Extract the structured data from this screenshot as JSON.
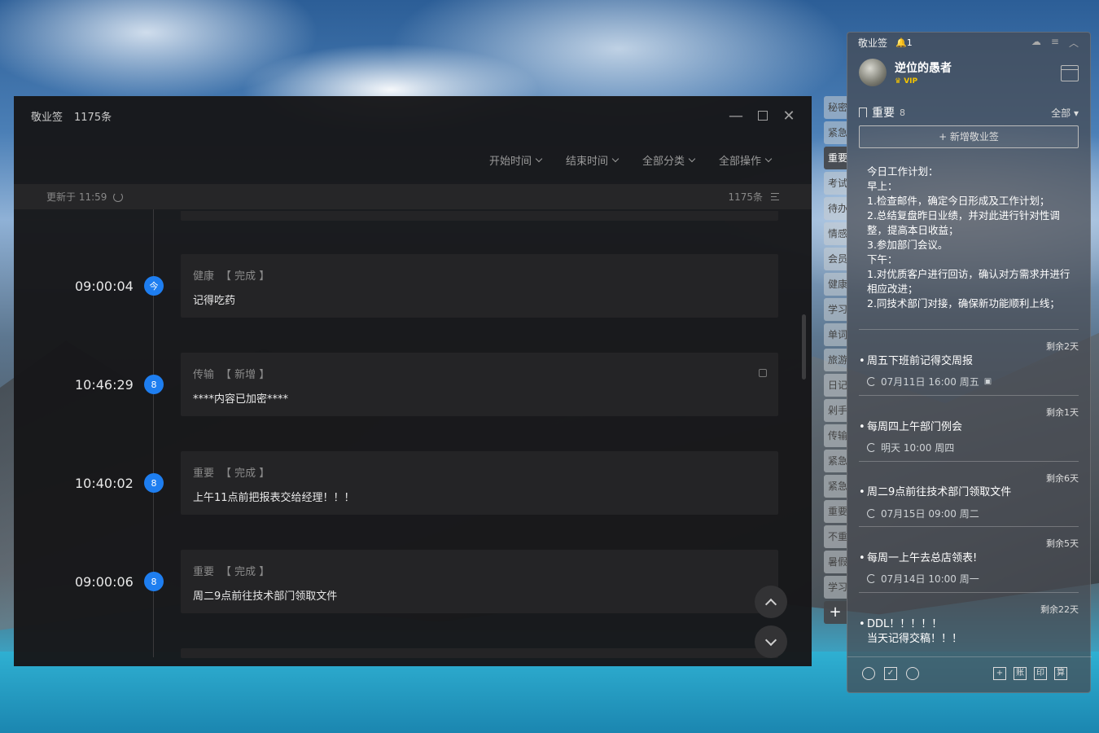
{
  "main": {
    "app_name": "敬业签",
    "total": "1175条",
    "filters": [
      "开始时间",
      "结束时间",
      "全部分类",
      "全部操作"
    ],
    "updated": "更新于 11:59",
    "count": "1175条",
    "entries": [
      {
        "time": "09:00:04",
        "badge": "今",
        "category": "健康",
        "status": "【 完成 】",
        "content": "记得吃药"
      },
      {
        "time": "10:46:29",
        "badge": "8",
        "category": "传输",
        "status": "【 新增 】",
        "content": "****内容已加密****"
      },
      {
        "time": "10:40:02",
        "badge": "8",
        "category": "重要",
        "status": "【 完成 】",
        "content": "上午11点前把报表交给经理！！！"
      },
      {
        "time": "09:00:06",
        "badge": "8",
        "category": "重要",
        "status": "【 完成 】",
        "content": "周二9点前往技术部门领取文件"
      }
    ]
  },
  "tabs": [
    "秘密",
    "紧急",
    "重要",
    "考试",
    "待办",
    "情感",
    "会员",
    "健康",
    "学习",
    "单词",
    "旅游",
    "日记",
    "剁手",
    "传输",
    "紧急",
    "紧急",
    "重要",
    "不重",
    "暑假",
    "学习"
  ],
  "tabs_plus": "+",
  "panel": {
    "title": "敬业签",
    "alert": "1",
    "user": "逆位的愚者",
    "vip": "VIP",
    "section": "重要",
    "section_count": "8",
    "filter": "全部",
    "new_button": "+ 新增敬业签",
    "plan": [
      "今日工作计划：",
      "早上：",
      "1.检查邮件，确定今日形成及工作计划；",
      "2.总结复盘昨日业绩，并对此进行针对性调整，提高本日收益；",
      "3.参加部门会议。",
      "下午：",
      "1.对优质客户进行回访，确认对方需求并进行相应改进；",
      "2.同技术部门对接，确保新功能顺利上线；"
    ],
    "items": [
      {
        "remain": "剩余2天",
        "title": "周五下班前记得交周报",
        "meta": "07月11日 16:00 周五"
      },
      {
        "remain": "剩余1天",
        "title": "每周四上午部门例会",
        "meta": "明天 10:00 周四"
      },
      {
        "remain": "剩余6天",
        "title": "周二9点前往技术部门领取文件",
        "meta": "07月15日 09:00 周二"
      },
      {
        "remain": "剩余5天",
        "title": "每周一上午去总店领表!",
        "meta": "07月14日 10:00 周一"
      },
      {
        "remain": "剩余22天",
        "title": "DDL！！！！！\n当天记得交稿！！！",
        "meta": ""
      }
    ],
    "footer_left": [
      "clock-icon",
      "check-icon",
      "search-icon"
    ],
    "footer_right": [
      "+",
      "账",
      "印",
      "算"
    ]
  }
}
